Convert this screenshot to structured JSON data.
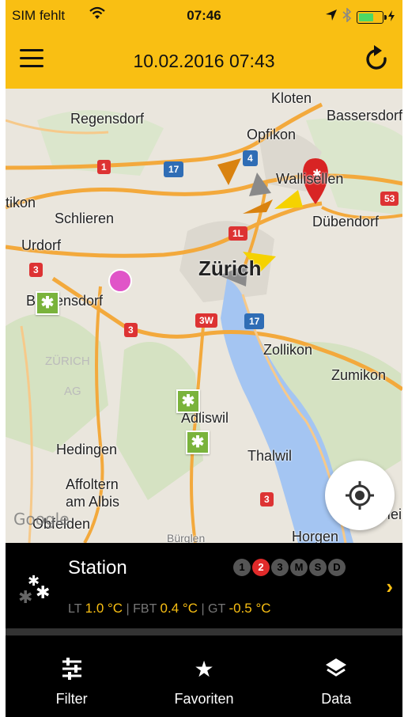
{
  "status_bar": {
    "carrier": "SIM fehlt",
    "time": "07:46"
  },
  "header": {
    "title": "10.02.2016 07:43",
    "background_color": "#f9bf13"
  },
  "map": {
    "places": [
      "Kloten",
      "Regensdorf",
      "Bassersdorf",
      "Opfikon",
      "Wallisellen",
      "tikon",
      "Schlieren",
      "Dübendorf",
      "Urdorf",
      "Zürich",
      "Birmensdorf",
      "Zollikon",
      "ZÜRICH",
      "Zumikon",
      "AG",
      "Adliswil",
      "Hedingen",
      "Thalwil",
      "Affoltern",
      "am Albis",
      "Obfelden",
      "Horgen",
      "Bürglen",
      "Meilen"
    ],
    "road_shields": [
      "1",
      "17",
      "4",
      "53",
      "1L",
      "3",
      "3W",
      "17",
      "3",
      "3"
    ],
    "attribution": "Google"
  },
  "station": {
    "name": "Station",
    "levels": [
      "1",
      "2",
      "3",
      "M",
      "S",
      "D"
    ],
    "active_level": "2",
    "lt_label": "LT",
    "lt_value": "1.0 °C",
    "fbt_label": "FBT",
    "fbt_value": "0.4 °C",
    "gt_label": "GT",
    "gt_value": "-0.5 °C",
    "separator": "|"
  },
  "tabs": [
    {
      "label": "Filter",
      "icon": "sliders-icon"
    },
    {
      "label": "Favoriten",
      "icon": "star-icon"
    },
    {
      "label": "Data",
      "icon": "layers-icon"
    }
  ],
  "colors": {
    "accent": "#f9bf13",
    "active_level": "#e02a2a",
    "station_marker": "#7ab33c",
    "lake": "#a4c5f2"
  }
}
